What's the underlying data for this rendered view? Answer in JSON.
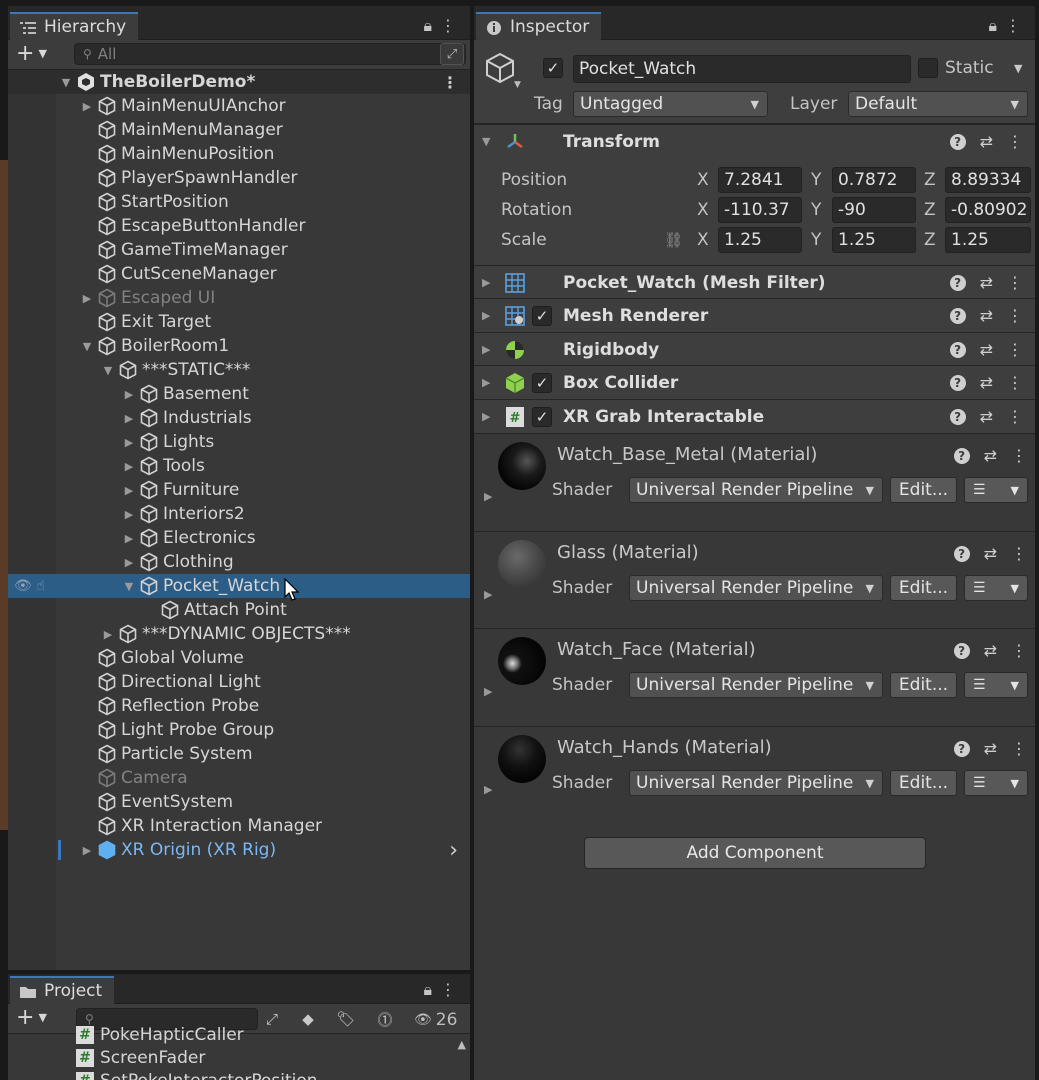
{
  "hierarchy": {
    "tab_label": "Hierarchy",
    "search_placeholder": "All",
    "scene_name": "TheBoilerDemo*",
    "items": [
      {
        "label": "MainMenuUIAnchor",
        "depth": 1,
        "arrow": "▶",
        "dim": false
      },
      {
        "label": "MainMenuManager",
        "depth": 1,
        "arrow": "",
        "dim": false
      },
      {
        "label": "MainMenuPosition",
        "depth": 1,
        "arrow": "",
        "dim": false
      },
      {
        "label": "PlayerSpawnHandler",
        "depth": 1,
        "arrow": "",
        "dim": false
      },
      {
        "label": "StartPosition",
        "depth": 1,
        "arrow": "",
        "dim": false
      },
      {
        "label": "EscapeButtonHandler",
        "depth": 1,
        "arrow": "",
        "dim": false
      },
      {
        "label": "GameTimeManager",
        "depth": 1,
        "arrow": "",
        "dim": false
      },
      {
        "label": "CutSceneManager",
        "depth": 1,
        "arrow": "",
        "dim": false
      },
      {
        "label": "Escaped UI",
        "depth": 1,
        "arrow": "▶",
        "dim": true
      },
      {
        "label": "Exit Target",
        "depth": 1,
        "arrow": "",
        "dim": false
      },
      {
        "label": "BoilerRoom1",
        "depth": 1,
        "arrow": "▼",
        "dim": false
      },
      {
        "label": "***STATIC***",
        "depth": 2,
        "arrow": "▼",
        "dim": false
      },
      {
        "label": "Basement",
        "depth": 3,
        "arrow": "▶",
        "dim": false
      },
      {
        "label": "Industrials",
        "depth": 3,
        "arrow": "▶",
        "dim": false
      },
      {
        "label": "Lights",
        "depth": 3,
        "arrow": "▶",
        "dim": false
      },
      {
        "label": "Tools",
        "depth": 3,
        "arrow": "▶",
        "dim": false
      },
      {
        "label": "Furniture",
        "depth": 3,
        "arrow": "▶",
        "dim": false
      },
      {
        "label": "Interiors2",
        "depth": 3,
        "arrow": "▶",
        "dim": false
      },
      {
        "label": "Electronics",
        "depth": 3,
        "arrow": "▶",
        "dim": false
      },
      {
        "label": "Clothing",
        "depth": 3,
        "arrow": "▶",
        "dim": false
      },
      {
        "label": "Pocket_Watch",
        "depth": 3,
        "arrow": "▼",
        "dim": false,
        "selected": true
      },
      {
        "label": "Attach Point",
        "depth": 4,
        "arrow": "",
        "dim": false
      },
      {
        "label": "***DYNAMIC OBJECTS***",
        "depth": 2,
        "arrow": "▶",
        "dim": false
      },
      {
        "label": "Global Volume",
        "depth": 1,
        "arrow": "",
        "dim": false
      },
      {
        "label": "Directional Light",
        "depth": 1,
        "arrow": "",
        "dim": false
      },
      {
        "label": "Reflection Probe",
        "depth": 1,
        "arrow": "",
        "dim": false
      },
      {
        "label": "Light Probe Group",
        "depth": 1,
        "arrow": "",
        "dim": false
      },
      {
        "label": "Particle System",
        "depth": 1,
        "arrow": "",
        "dim": false
      },
      {
        "label": "Camera",
        "depth": 1,
        "arrow": "",
        "dim": true
      },
      {
        "label": "EventSystem",
        "depth": 1,
        "arrow": "",
        "dim": false
      },
      {
        "label": "XR Interaction Manager",
        "depth": 1,
        "arrow": "",
        "dim": false
      },
      {
        "label": "XR Origin (XR Rig)",
        "depth": 1,
        "arrow": "▶",
        "dim": false,
        "prefab": true
      }
    ]
  },
  "project": {
    "tab_label": "Project",
    "visible_count": "26",
    "items": [
      "PokeHapticCaller",
      "ScreenFader",
      "SetPokeInteractorPosition"
    ]
  },
  "inspector": {
    "tab_label": "Inspector",
    "object_name": "Pocket_Watch",
    "static_label": "Static",
    "tag_label": "Tag",
    "tag_value": "Untagged",
    "layer_label": "Layer",
    "layer_value": "Default",
    "transform": {
      "title": "Transform",
      "rows": [
        {
          "label": "Position",
          "x": "7.2841",
          "y": "0.7872",
          "z": "8.89334"
        },
        {
          "label": "Rotation",
          "x": "-110.37",
          "y": "-90",
          "z": "-0.80902"
        },
        {
          "label": "Scale",
          "x": "1.25",
          "y": "1.25",
          "z": "1.25"
        }
      ]
    },
    "components": [
      {
        "name": "Pocket_Watch (Mesh Filter)",
        "icon": "mesh-filter-icon",
        "checkbox": false
      },
      {
        "name": "Mesh Renderer",
        "icon": "mesh-renderer-icon",
        "checkbox": true
      },
      {
        "name": "Rigidbody",
        "icon": "rigidbody-icon",
        "checkbox": false
      },
      {
        "name": "Box Collider",
        "icon": "box-collider-icon",
        "checkbox": true
      },
      {
        "name": "XR Grab Interactable",
        "icon": "script-icon",
        "checkbox": true
      }
    ],
    "materials": [
      {
        "name": "Watch_Base_Metal (Material)",
        "shader": "Universal Render Pipeline",
        "edit": "Edit...",
        "shader_label": "Shader"
      },
      {
        "name": "Glass (Material)",
        "shader": "Universal Render Pipeline",
        "edit": "Edit...",
        "shader_label": "Shader"
      },
      {
        "name": "Watch_Face (Material)",
        "shader": "Universal Render Pipeline",
        "edit": "Edit...",
        "shader_label": "Shader"
      },
      {
        "name": "Watch_Hands (Material)",
        "shader": "Universal Render Pipeline",
        "edit": "Edit...",
        "shader_label": "Shader"
      }
    ],
    "add_component_label": "Add Component"
  },
  "colors": {
    "selection": "#2c5d87",
    "accent": "#3a79bb",
    "prefab_text": "#7cb7f4"
  }
}
